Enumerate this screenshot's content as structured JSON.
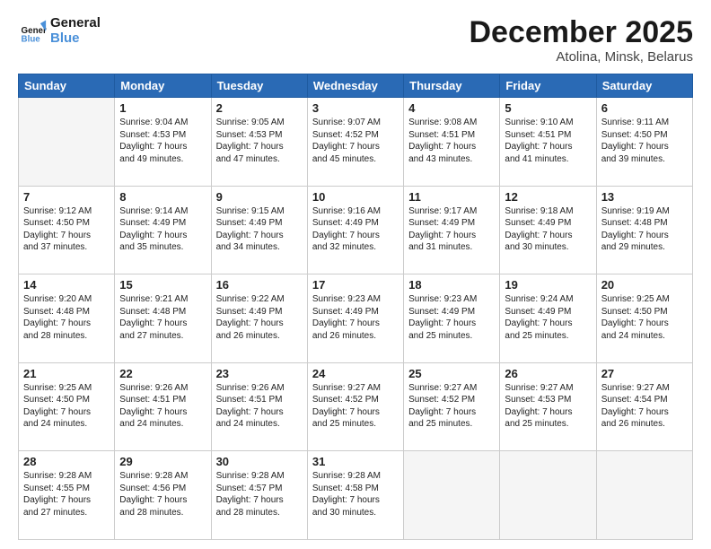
{
  "logo": {
    "line1": "General",
    "line2": "Blue"
  },
  "title": "December 2025",
  "subtitle": "Atolina, Minsk, Belarus",
  "days_header": [
    "Sunday",
    "Monday",
    "Tuesday",
    "Wednesday",
    "Thursday",
    "Friday",
    "Saturday"
  ],
  "weeks": [
    [
      {
        "num": "",
        "info": ""
      },
      {
        "num": "1",
        "info": "Sunrise: 9:04 AM\nSunset: 4:53 PM\nDaylight: 7 hours\nand 49 minutes."
      },
      {
        "num": "2",
        "info": "Sunrise: 9:05 AM\nSunset: 4:53 PM\nDaylight: 7 hours\nand 47 minutes."
      },
      {
        "num": "3",
        "info": "Sunrise: 9:07 AM\nSunset: 4:52 PM\nDaylight: 7 hours\nand 45 minutes."
      },
      {
        "num": "4",
        "info": "Sunrise: 9:08 AM\nSunset: 4:51 PM\nDaylight: 7 hours\nand 43 minutes."
      },
      {
        "num": "5",
        "info": "Sunrise: 9:10 AM\nSunset: 4:51 PM\nDaylight: 7 hours\nand 41 minutes."
      },
      {
        "num": "6",
        "info": "Sunrise: 9:11 AM\nSunset: 4:50 PM\nDaylight: 7 hours\nand 39 minutes."
      }
    ],
    [
      {
        "num": "7",
        "info": "Sunrise: 9:12 AM\nSunset: 4:50 PM\nDaylight: 7 hours\nand 37 minutes."
      },
      {
        "num": "8",
        "info": "Sunrise: 9:14 AM\nSunset: 4:49 PM\nDaylight: 7 hours\nand 35 minutes."
      },
      {
        "num": "9",
        "info": "Sunrise: 9:15 AM\nSunset: 4:49 PM\nDaylight: 7 hours\nand 34 minutes."
      },
      {
        "num": "10",
        "info": "Sunrise: 9:16 AM\nSunset: 4:49 PM\nDaylight: 7 hours\nand 32 minutes."
      },
      {
        "num": "11",
        "info": "Sunrise: 9:17 AM\nSunset: 4:49 PM\nDaylight: 7 hours\nand 31 minutes."
      },
      {
        "num": "12",
        "info": "Sunrise: 9:18 AM\nSunset: 4:49 PM\nDaylight: 7 hours\nand 30 minutes."
      },
      {
        "num": "13",
        "info": "Sunrise: 9:19 AM\nSunset: 4:48 PM\nDaylight: 7 hours\nand 29 minutes."
      }
    ],
    [
      {
        "num": "14",
        "info": "Sunrise: 9:20 AM\nSunset: 4:48 PM\nDaylight: 7 hours\nand 28 minutes."
      },
      {
        "num": "15",
        "info": "Sunrise: 9:21 AM\nSunset: 4:48 PM\nDaylight: 7 hours\nand 27 minutes."
      },
      {
        "num": "16",
        "info": "Sunrise: 9:22 AM\nSunset: 4:49 PM\nDaylight: 7 hours\nand 26 minutes."
      },
      {
        "num": "17",
        "info": "Sunrise: 9:23 AM\nSunset: 4:49 PM\nDaylight: 7 hours\nand 26 minutes."
      },
      {
        "num": "18",
        "info": "Sunrise: 9:23 AM\nSunset: 4:49 PM\nDaylight: 7 hours\nand 25 minutes."
      },
      {
        "num": "19",
        "info": "Sunrise: 9:24 AM\nSunset: 4:49 PM\nDaylight: 7 hours\nand 25 minutes."
      },
      {
        "num": "20",
        "info": "Sunrise: 9:25 AM\nSunset: 4:50 PM\nDaylight: 7 hours\nand 24 minutes."
      }
    ],
    [
      {
        "num": "21",
        "info": "Sunrise: 9:25 AM\nSunset: 4:50 PM\nDaylight: 7 hours\nand 24 minutes."
      },
      {
        "num": "22",
        "info": "Sunrise: 9:26 AM\nSunset: 4:51 PM\nDaylight: 7 hours\nand 24 minutes."
      },
      {
        "num": "23",
        "info": "Sunrise: 9:26 AM\nSunset: 4:51 PM\nDaylight: 7 hours\nand 24 minutes."
      },
      {
        "num": "24",
        "info": "Sunrise: 9:27 AM\nSunset: 4:52 PM\nDaylight: 7 hours\nand 25 minutes."
      },
      {
        "num": "25",
        "info": "Sunrise: 9:27 AM\nSunset: 4:52 PM\nDaylight: 7 hours\nand 25 minutes."
      },
      {
        "num": "26",
        "info": "Sunrise: 9:27 AM\nSunset: 4:53 PM\nDaylight: 7 hours\nand 25 minutes."
      },
      {
        "num": "27",
        "info": "Sunrise: 9:27 AM\nSunset: 4:54 PM\nDaylight: 7 hours\nand 26 minutes."
      }
    ],
    [
      {
        "num": "28",
        "info": "Sunrise: 9:28 AM\nSunset: 4:55 PM\nDaylight: 7 hours\nand 27 minutes."
      },
      {
        "num": "29",
        "info": "Sunrise: 9:28 AM\nSunset: 4:56 PM\nDaylight: 7 hours\nand 28 minutes."
      },
      {
        "num": "30",
        "info": "Sunrise: 9:28 AM\nSunset: 4:57 PM\nDaylight: 7 hours\nand 28 minutes."
      },
      {
        "num": "31",
        "info": "Sunrise: 9:28 AM\nSunset: 4:58 PM\nDaylight: 7 hours\nand 30 minutes."
      },
      {
        "num": "",
        "info": ""
      },
      {
        "num": "",
        "info": ""
      },
      {
        "num": "",
        "info": ""
      }
    ]
  ]
}
